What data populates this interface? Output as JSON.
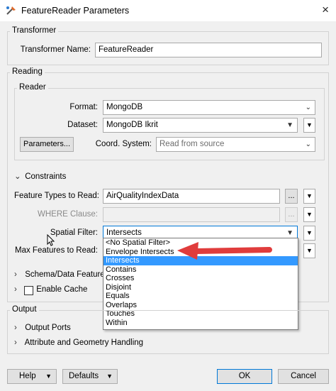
{
  "window": {
    "title": "FeatureReader Parameters",
    "close_icon": "×"
  },
  "transformer": {
    "group_label": "Transformer",
    "name_label": "Transformer Name:",
    "name_value": "FeatureReader"
  },
  "reading": {
    "group_label": "Reading",
    "reader": {
      "group_label": "Reader",
      "format_label": "Format:",
      "format_value": "MongoDB",
      "dataset_label": "Dataset:",
      "dataset_value": "MongoDB Ikrit",
      "parameters_button": "Parameters...",
      "coord_label": "Coord. System:",
      "coord_placeholder": "Read from source"
    },
    "constraints": {
      "label": "Constraints",
      "feature_types_label": "Feature Types to Read:",
      "feature_types_value": "AirQualityIndexData",
      "ellipsis": "...",
      "where_label": "WHERE Clause:",
      "spatial_filter_label": "Spatial Filter:",
      "spatial_filter_value": "Intersects",
      "max_features_label": "Max Features to Read:"
    },
    "schema_label": "Schema/Data Features",
    "enable_cache_label": "Enable Cache"
  },
  "spatial_filter_options": [
    "<No Spatial Filter>",
    "Envelope Intersects",
    "Intersects",
    "Contains",
    "Crosses",
    "Disjoint",
    "Equals",
    "Overlaps",
    "Touches",
    "Within"
  ],
  "selected_option": "Intersects",
  "output": {
    "group_label": "Output",
    "output_ports": "Output Ports",
    "attr_geom": "Attribute and Geometry Handling"
  },
  "buttons": {
    "help": "Help",
    "defaults": "Defaults",
    "ok": "OK",
    "cancel": "Cancel"
  },
  "colors": {
    "selection": "#3399ff",
    "arrow": "#e03c3c",
    "ok_border": "#0078d7"
  }
}
